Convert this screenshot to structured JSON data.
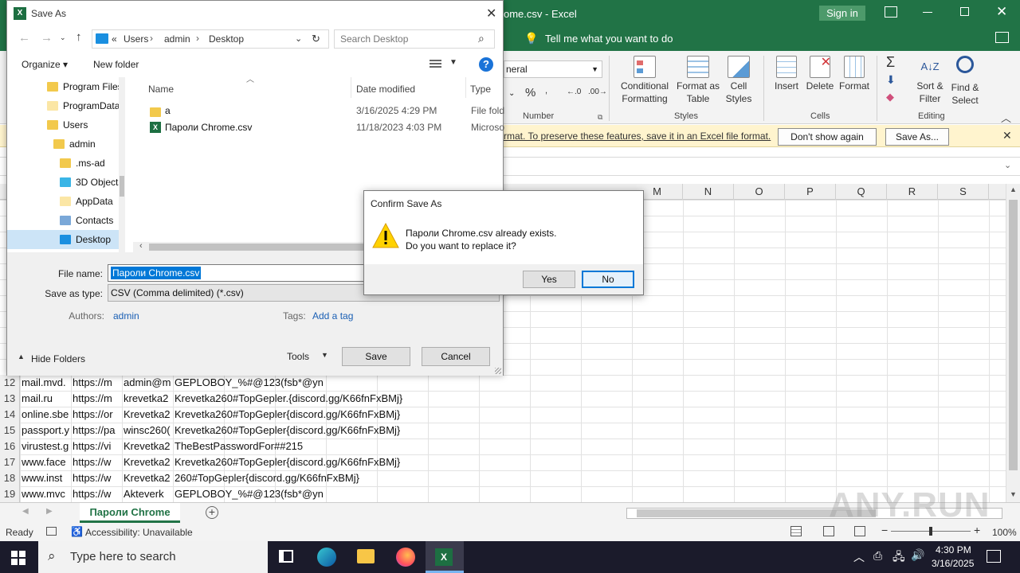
{
  "excel": {
    "title": "Пароли Chrome.csv - Excel",
    "title_visible": "ome.csv  -  Excel",
    "signin": "Sign in",
    "tell_me": "Tell me what you want to do",
    "number_format": "neral",
    "ribbon": {
      "conditional_formatting": [
        "Conditional",
        "Formatting"
      ],
      "format_as_table": [
        "Format as",
        "Table"
      ],
      "cell_styles": [
        "Cell",
        "Styles"
      ],
      "insert": "Insert",
      "delete": "Delete",
      "format": "Format",
      "sort_filter": [
        "Sort &",
        "Filter"
      ],
      "find_select": [
        "Find &",
        "Select"
      ],
      "percent": "%",
      "group_number": "Number",
      "group_styles": "Styles",
      "group_cells": "Cells",
      "group_editing": "Editing"
    },
    "message_bar": {
      "text": "rmat. To preserve these features, save it in an Excel file format.",
      "dont_show": "Don't show again",
      "save_as": "Save As..."
    },
    "columns": [
      "M",
      "N",
      "O",
      "P",
      "Q",
      "R",
      "S"
    ],
    "rows": [
      {
        "n": "12",
        "a": "mail.mvd.",
        "b": "https://m",
        "c": "admin@m",
        "d": "GEPLOBOY_%#@123(fsb*@yn"
      },
      {
        "n": "13",
        "a": "mail.ru",
        "b": "https://m",
        "c": "krevetka2",
        "d": "Krevetka260#TopGepler.{discord.gg/K66fnFxBMj}"
      },
      {
        "n": "14",
        "a": "online.sbe",
        "b": "https://or",
        "c": "Krevetka2",
        "d": "Krevetka260#TopGepler{discord.gg/K66fnFxBMj}"
      },
      {
        "n": "15",
        "a": "passport.y",
        "b": "https://pa",
        "c": "winsc260(",
        "d": "Krevetka260#TopGepler{discord.gg/K66fnFxBMj}"
      },
      {
        "n": "16",
        "a": "virustest.g",
        "b": "https://vi",
        "c": "Krevetka2",
        "d": "TheBestPasswordFor##215"
      },
      {
        "n": "17",
        "a": "www.face",
        "b": "https://w",
        "c": "Krevetka2",
        "d": "Krevetka260#TopGepler{discord.gg/K66fnFxBMj}"
      },
      {
        "n": "18",
        "a": "www.inst",
        "b": "https://w",
        "c": "Krevetka2",
        "d": "260#TopGepler{discord.gg/K66fnFxBMj}"
      },
      {
        "n": "19",
        "a": "www.mvc",
        "b": "https://w",
        "c": "Akteverk",
        "d": "GEPLOBOY_%#@123(fsb*@yn"
      }
    ],
    "sheet_tab": "Пароли Chrome",
    "status_ready": "Ready",
    "accessibility": "Accessibility: Unavailable",
    "zoom": "100%"
  },
  "saveas": {
    "title": "Save As",
    "breadcrumb": [
      "«",
      "Users",
      "admin",
      "Desktop"
    ],
    "search_placeholder": "Search Desktop",
    "organize": "Organize ▾",
    "new_folder": "New folder",
    "nav_items": [
      "Program Files",
      "ProgramData",
      "Users",
      "admin",
      ".ms-ad",
      "3D Objects",
      "AppData",
      "Contacts",
      "Desktop"
    ],
    "col_name": "Name",
    "col_date": "Date modified",
    "col_type": "Type",
    "files": [
      {
        "name": "a",
        "date": "3/16/2025 4:29 PM",
        "type": "File fold"
      },
      {
        "name": "Пароли Chrome.csv",
        "date": "11/18/2023 4:03 PM",
        "type": "Microso"
      }
    ],
    "file_name_label": "File name:",
    "file_name_value": "Пароли Chrome.csv",
    "save_type_label": "Save as type:",
    "save_type_value": "CSV (Comma delimited) (*.csv)",
    "authors_label": "Authors:",
    "authors_value": "admin",
    "tags_label": "Tags:",
    "tags_value": "Add a tag",
    "hide_folders": "Hide Folders",
    "tools": "Tools",
    "save": "Save",
    "cancel": "Cancel"
  },
  "confirm": {
    "title": "Confirm Save As",
    "line1": "Пароли Chrome.csv already exists.",
    "line2": "Do you want to replace it?",
    "yes": "Yes",
    "no": "No"
  },
  "taskbar": {
    "search_placeholder": "Type here to search",
    "time": "4:30 PM",
    "date": "3/16/2025"
  },
  "watermark": "ANY.RUN"
}
